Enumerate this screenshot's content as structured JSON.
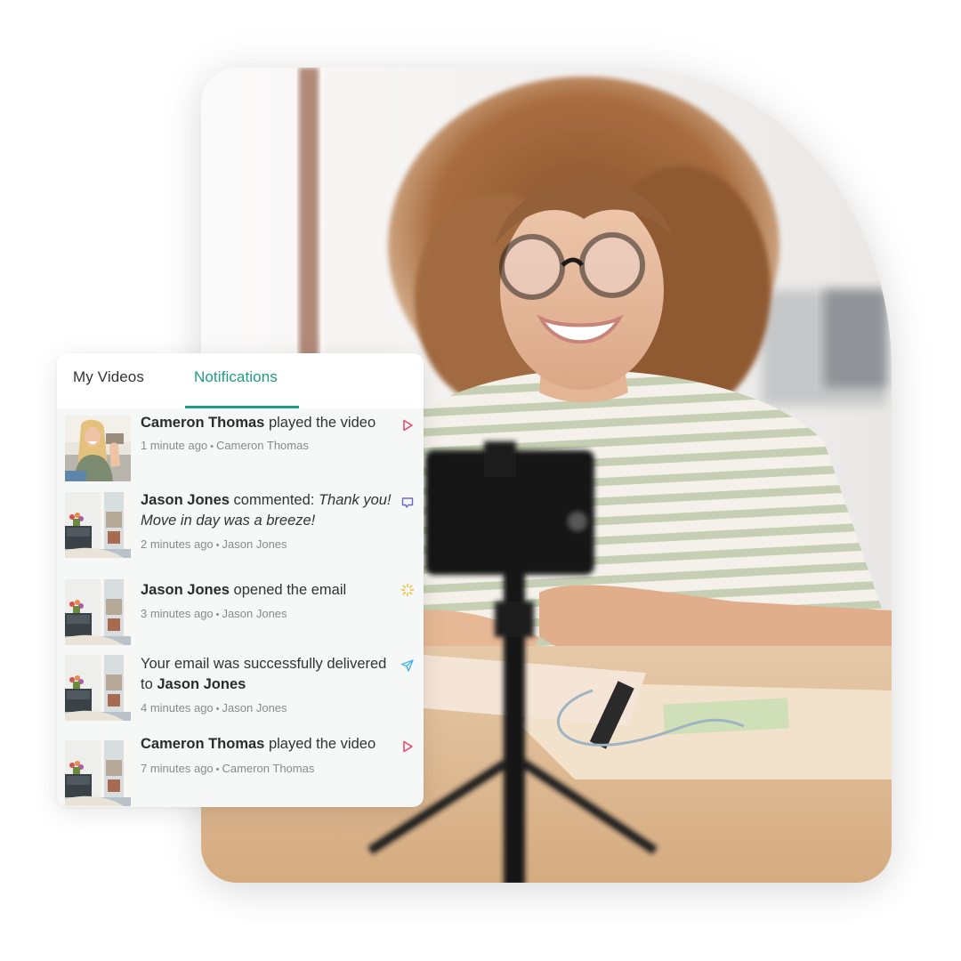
{
  "tabs": [
    {
      "label": "My Videos",
      "active": false
    },
    {
      "label": "Notifications",
      "active": true
    }
  ],
  "accent_color": "#1f9d82",
  "notifications": [
    {
      "thumbnail": "woman-waving-photo",
      "actor": "Cameron Thomas",
      "prefix": "",
      "action": " played the video",
      "quote": "",
      "time": "1 minute ago",
      "contact": "Cameron Thomas",
      "icon": "play-icon",
      "icon_color": "#e8476b"
    },
    {
      "thumbnail": "living-room-photo",
      "actor": "Jason Jones",
      "prefix": "",
      "action": " commented: ",
      "quote": "Thank you! Move in day was a breeze!",
      "time": "2 minutes ago",
      "contact": "Jason Jones",
      "icon": "comment-icon",
      "icon_color": "#6b68c9"
    },
    {
      "thumbnail": "living-room-photo",
      "actor": "Jason Jones",
      "prefix": "",
      "action": " opened the email",
      "quote": "",
      "time": "3 minutes ago",
      "contact": "Jason Jones",
      "icon": "sparkle-icon",
      "icon_color": "#f5b82e"
    },
    {
      "thumbnail": "living-room-photo",
      "actor": "Jason Jones",
      "prefix": "Your email was successfully delivered to ",
      "action": "",
      "quote": "",
      "time": "4 minutes ago",
      "contact": "Jason Jones",
      "icon": "send-icon",
      "icon_color": "#4ab3e8"
    },
    {
      "thumbnail": "living-room-photo",
      "actor": "Cameron Thomas",
      "prefix": "",
      "action": " played the video",
      "quote": "",
      "time": "7 minutes ago",
      "contact": "Cameron Thomas",
      "icon": "play-icon",
      "icon_color": "#e8476b"
    }
  ],
  "hero_image": "woman-with-curly-hair-recording-video-on-phone-tripod"
}
